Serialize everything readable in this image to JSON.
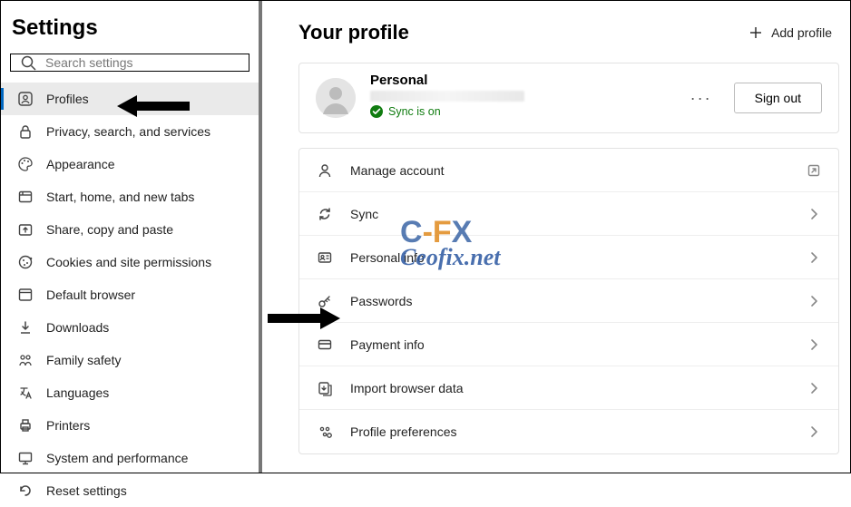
{
  "sidebar": {
    "title": "Settings",
    "search_placeholder": "Search settings",
    "items": [
      {
        "icon": "profile-icon",
        "label": "Profiles",
        "active": true
      },
      {
        "icon": "lock-icon",
        "label": "Privacy, search, and services"
      },
      {
        "icon": "appearance-icon",
        "label": "Appearance"
      },
      {
        "icon": "tab-icon",
        "label": "Start, home, and new tabs"
      },
      {
        "icon": "share-icon",
        "label": "Share, copy and paste"
      },
      {
        "icon": "cookie-icon",
        "label": "Cookies and site permissions"
      },
      {
        "icon": "browser-icon",
        "label": "Default browser"
      },
      {
        "icon": "download-icon",
        "label": "Downloads"
      },
      {
        "icon": "family-icon",
        "label": "Family safety"
      },
      {
        "icon": "language-icon",
        "label": "Languages"
      },
      {
        "icon": "printer-icon",
        "label": "Printers"
      },
      {
        "icon": "system-icon",
        "label": "System and performance"
      },
      {
        "icon": "reset-icon",
        "label": "Reset settings"
      }
    ]
  },
  "header": {
    "title": "Your profile",
    "add_profile_label": "Add profile"
  },
  "profile": {
    "name": "Personal",
    "sync_label": "Sync is on",
    "more_label": "More actions",
    "signout_label": "Sign out"
  },
  "rows": [
    {
      "icon": "person-icon",
      "label": "Manage account",
      "trail": "external"
    },
    {
      "icon": "sync-icon",
      "label": "Sync",
      "trail": "chevron"
    },
    {
      "icon": "personal-info-icon",
      "label": "Personal info",
      "trail": "chevron"
    },
    {
      "icon": "key-icon",
      "label": "Passwords",
      "trail": "chevron"
    },
    {
      "icon": "card-icon",
      "label": "Payment info",
      "trail": "chevron"
    },
    {
      "icon": "import-icon",
      "label": "Import browser data",
      "trail": "chevron"
    },
    {
      "icon": "prefs-icon",
      "label": "Profile preferences",
      "trail": "chevron"
    }
  ],
  "watermark": {
    "top1": "C",
    "top2": "-F",
    "top3": "X",
    "bottom": "Ceofix.net"
  }
}
